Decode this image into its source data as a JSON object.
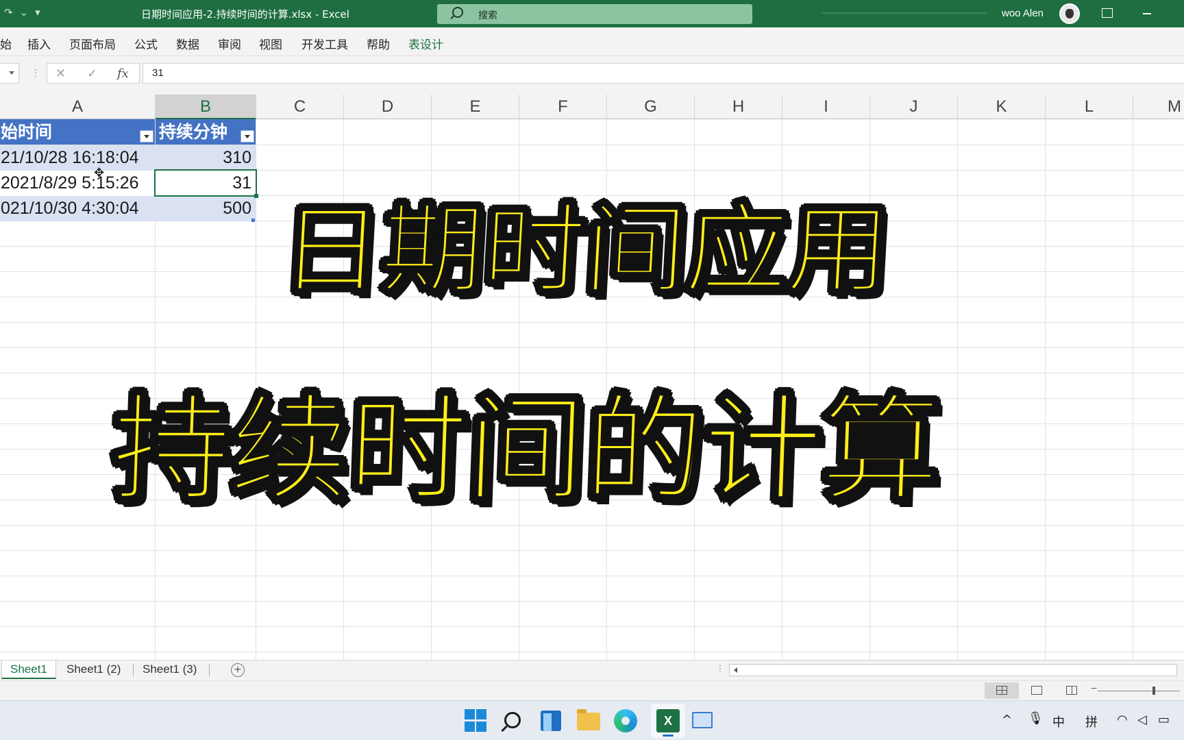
{
  "window": {
    "title": "日期时间应用-2.持续时间的计算.xlsx  -  Excel",
    "search_placeholder": "搜索",
    "user_name": "woo Alen",
    "qat_redo": "↷",
    "qat_dropdown": "⌄",
    "qat_customize": "▾"
  },
  "ribbon": {
    "tabs": [
      {
        "label": "始"
      },
      {
        "label": "插入"
      },
      {
        "label": "页面布局"
      },
      {
        "label": "公式"
      },
      {
        "label": "数据"
      },
      {
        "label": "审阅"
      },
      {
        "label": "视图"
      },
      {
        "label": "开发工具"
      },
      {
        "label": "帮助"
      },
      {
        "label": "表设计"
      }
    ],
    "active_tab": "表设计"
  },
  "formula_bar": {
    "cancel": "✕",
    "enter": "✓",
    "fx": "fx",
    "value": "31"
  },
  "columns": [
    "A",
    "B",
    "C",
    "D",
    "E",
    "F",
    "G",
    "H",
    "I",
    "J",
    "K",
    "L",
    "M"
  ],
  "selected_column": "B",
  "table": {
    "headers": [
      "始时间",
      "持续分钟"
    ],
    "rows": [
      {
        "a": "21/10/28 16:18:04",
        "b": "310"
      },
      {
        "a": "2021/8/29 5:15:26",
        "b": "31"
      },
      {
        "a": "021/10/30 4:30:04",
        "b": "500"
      }
    ],
    "active_cell": "B3"
  },
  "overlay": {
    "title_line1": "日期时间应用",
    "title_line2": "持续时间的计算"
  },
  "sheets": {
    "tabs": [
      "Sheet1",
      "Sheet1 (2)",
      "Sheet1 (3)"
    ],
    "active": "Sheet1",
    "add": "+"
  },
  "taskbar": {
    "excel_label": "X",
    "tray": {
      "chevron": "^",
      "ime_lang": "中",
      "ime_mode": "拼"
    }
  },
  "colors": {
    "excel_green": "#1e6e42",
    "table_header": "#4472c4",
    "table_band": "#d9e1f2",
    "overlay_fill": "#ffee18",
    "overlay_stroke": "#111111"
  }
}
